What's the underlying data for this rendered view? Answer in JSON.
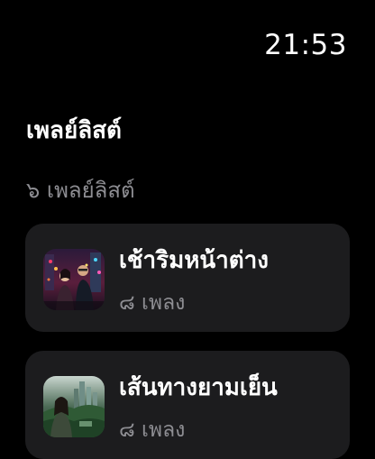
{
  "status_bar": {
    "time": "21:53"
  },
  "header": {
    "title": "เพลย์ลิสต์",
    "count_label": "๖ เพลย์ลิสต์"
  },
  "playlists": [
    {
      "title": "เช้าริมหน้าต่าง",
      "subtitle": "๘ เพลง",
      "thumbnail_icon": "playlist-cover-city-night"
    },
    {
      "title": "เส้นทางยามเย็น",
      "subtitle": "๘ เพลง",
      "thumbnail_icon": "playlist-cover-green-city"
    }
  ]
}
